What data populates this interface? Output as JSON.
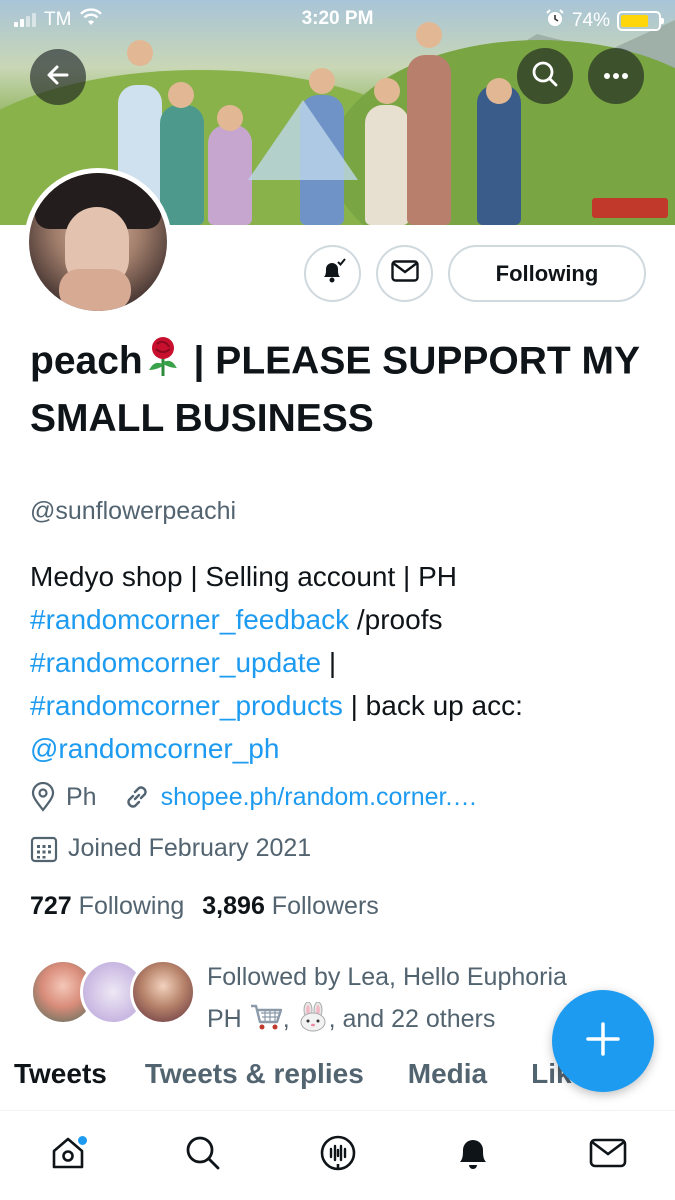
{
  "status_bar": {
    "carrier": "TM",
    "time": "3:20 PM",
    "battery": "74%",
    "battery_level": 0.74
  },
  "header": {
    "back_icon": "arrow-left-icon",
    "search_icon": "search-icon",
    "more_icon": "more-horizontal-icon"
  },
  "actions": {
    "notify_icon": "bell-check-icon",
    "message_icon": "envelope-icon",
    "follow_label": "Following"
  },
  "profile": {
    "name_part1": "peach",
    "name_emoji": "rose-icon",
    "name_part2": " | PLEASE SUPPORT MY SMALL BUSINESS",
    "handle": "@sunflowerpeachi",
    "bio_line1": "Medyo shop | Selling account | PH",
    "bio_tag1": "#randomcorner_feedback",
    "bio_text2": " /proofs",
    "bio_tag2": "#randomcorner_update",
    "bio_text3": " |",
    "bio_tag3": "#randomcorner_products",
    "bio_text4": " | back up acc:",
    "bio_mention": "@randomcorner_ph",
    "location": "Ph",
    "url": "shopee.ph/random.corner.…",
    "joined": "Joined February 2021",
    "following_count": "727",
    "following_label": "Following",
    "followers_count": "3,896",
    "followers_label": "Followers",
    "followed_by_1": "Followed by Lea, Hello Euphoria",
    "followed_by_2a": "PH",
    "followed_by_2b": ",",
    "followed_by_2c": ", and 22 others"
  },
  "tabs": [
    "Tweets",
    "Tweets & replies",
    "Media",
    "Likes"
  ],
  "fab_icon": "plus-icon",
  "bottom_nav": [
    "home-icon",
    "search-icon",
    "spaces-icon",
    "notifications-icon",
    "messages-icon"
  ]
}
